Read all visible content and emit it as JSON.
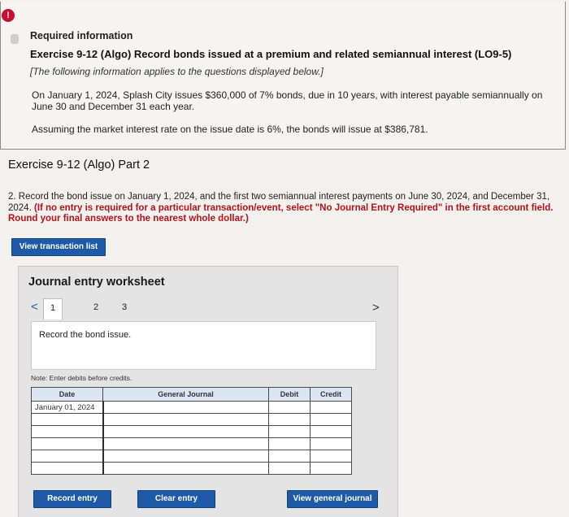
{
  "info": {
    "alert_glyph": "!",
    "required_label": "Required information",
    "exercise_title": "Exercise 9-12 (Algo) Record bonds issued at a premium and related semiannual interest (LO9-5)",
    "applies_note": "[The following information applies to the questions displayed below.]",
    "paragraph1": "On January 1, 2024, Splash City issues $360,000 of 7% bonds, due in 10 years, with interest payable semiannually on June 30 and December 31 each year.",
    "paragraph2": "Assuming the market interest rate on the issue date is 6%, the bonds will issue at $386,781."
  },
  "part": {
    "title": "Exercise 9-12 (Algo) Part 2",
    "question_plain": "2. Record the bond issue on January 1, 2024, and the first two semiannual interest payments on June 30, 2024, and December 31, 2024. ",
    "question_bold": "(If no entry is required for a particular transaction/event, select \"No Journal Entry Required\" in the first account field. Round your final answers to the nearest whole dollar.)"
  },
  "buttons": {
    "view_transaction_list": "View transaction list",
    "record_entry": "Record entry",
    "clear_entry": "Clear entry",
    "view_general_journal": "View general journal"
  },
  "worksheet": {
    "title": "Journal entry worksheet",
    "nav_prev": "<",
    "nav_next": ">",
    "pages": [
      "1",
      "2",
      "3"
    ],
    "record_text": "Record the bond issue.",
    "note": "Note: Enter debits before credits.",
    "columns": {
      "date": "Date",
      "general_journal": "General Journal",
      "debit": "Debit",
      "credit": "Credit"
    },
    "rows": [
      {
        "date": "January 01, 2024",
        "account": "",
        "debit": "",
        "credit": ""
      },
      {
        "date": "",
        "account": "",
        "debit": "",
        "credit": ""
      },
      {
        "date": "",
        "account": "",
        "debit": "",
        "credit": ""
      },
      {
        "date": "",
        "account": "",
        "debit": "",
        "credit": ""
      },
      {
        "date": "",
        "account": "",
        "debit": "",
        "credit": ""
      },
      {
        "date": "",
        "account": "",
        "debit": "",
        "credit": ""
      }
    ]
  },
  "colors": {
    "accent_blue": "#1e5aa8",
    "alert_red": "#c8102e",
    "instruction_red": "#b5121b"
  }
}
